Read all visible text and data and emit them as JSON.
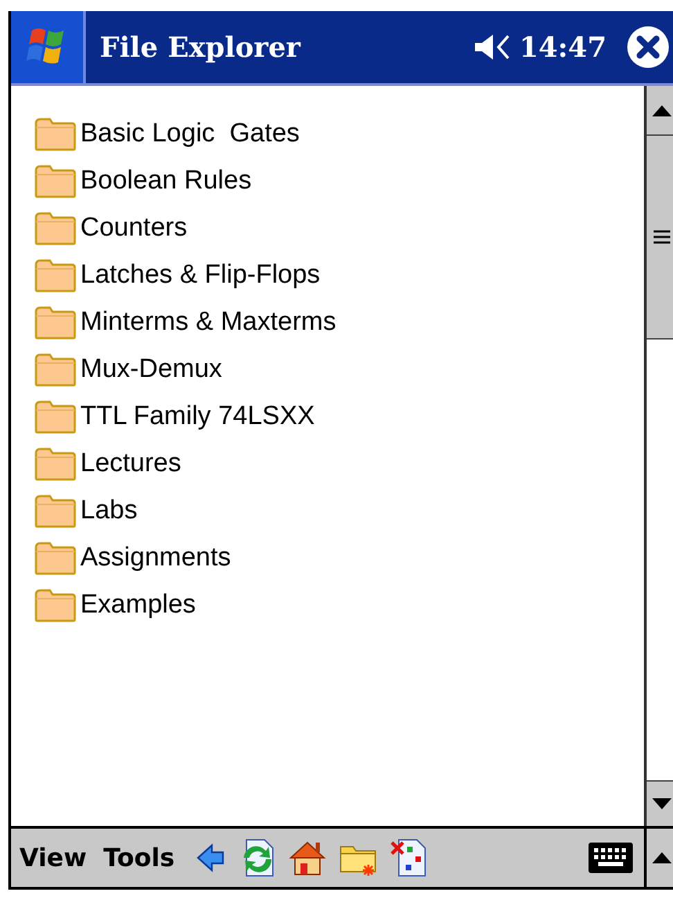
{
  "window": {
    "title": "File Explorer",
    "time": "14:47"
  },
  "folders": [
    {
      "name": "Basic Logic  Gates"
    },
    {
      "name": "Boolean Rules"
    },
    {
      "name": "Counters"
    },
    {
      "name": "Latches & Flip-Flops"
    },
    {
      "name": "Minterms & Maxterms"
    },
    {
      "name": "Mux-Demux"
    },
    {
      "name": "TTL Family 74LSXX"
    },
    {
      "name": "Lectures"
    },
    {
      "name": "Labs"
    },
    {
      "name": "Assignments"
    },
    {
      "name": "Examples"
    }
  ],
  "menu_bar": {
    "menus": [
      "View",
      "Tools"
    ]
  }
}
